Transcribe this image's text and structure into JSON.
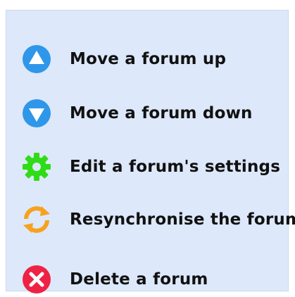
{
  "menu": {
    "items": [
      {
        "label": "Move a forum up",
        "icon": "arrow-up-circle-icon",
        "color": "#2e97ea"
      },
      {
        "label": "Move a forum down",
        "icon": "arrow-down-circle-icon",
        "color": "#2e97ea"
      },
      {
        "label": "Edit a forum's settings",
        "icon": "gear-icon",
        "color": "#2fdc16"
      },
      {
        "label": "Resynchronise the forum",
        "icon": "refresh-icon",
        "color": "#f6a21e"
      },
      {
        "label": "Delete a forum",
        "icon": "delete-x-circle-icon",
        "color": "#ee2244"
      }
    ]
  }
}
